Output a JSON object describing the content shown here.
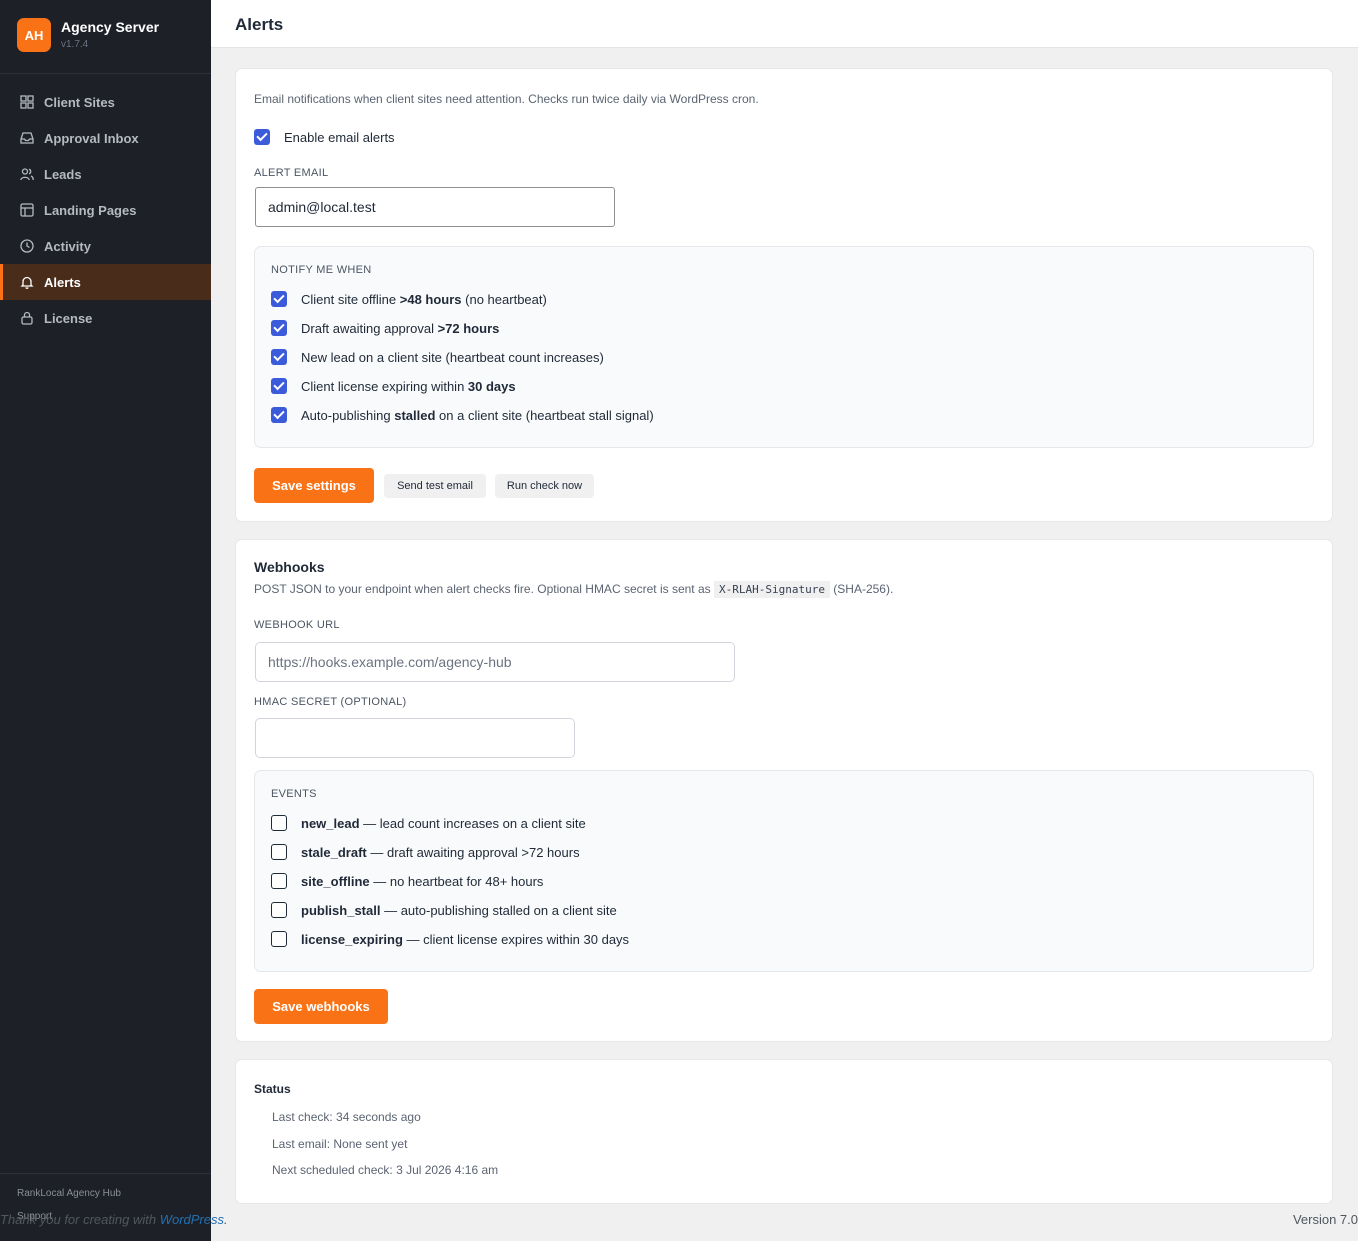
{
  "app": {
    "logo": "AH",
    "title": "Agency Server",
    "version": "v1.7.4"
  },
  "nav": [
    {
      "label": "Client Sites",
      "icon": "grid-icon"
    },
    {
      "label": "Approval Inbox",
      "icon": "inbox-icon"
    },
    {
      "label": "Leads",
      "icon": "users-icon"
    },
    {
      "label": "Landing Pages",
      "icon": "layout-icon"
    },
    {
      "label": "Activity",
      "icon": "clock-icon"
    },
    {
      "label": "Alerts",
      "icon": "bell-icon",
      "active": true
    },
    {
      "label": "License",
      "icon": "lock-icon"
    }
  ],
  "sidebar_footer": {
    "brand": "RankLocal Agency Hub",
    "support": "Support"
  },
  "page": {
    "title": "Alerts"
  },
  "email_card": {
    "description": "Email notifications when client sites need attention. Checks run twice daily via WordPress cron.",
    "enable_label": "Enable email alerts",
    "enable_checked": true,
    "email_label": "ALERT EMAIL",
    "email_value": "admin@local.test",
    "notify_label": "NOTIFY ME WHEN",
    "notify_items": [
      {
        "pre": "Client site offline ",
        "bold": ">48 hours",
        "post": " (no heartbeat)",
        "checked": true
      },
      {
        "pre": "Draft awaiting approval ",
        "bold": ">72 hours",
        "post": "",
        "checked": true
      },
      {
        "pre": "New lead on a client site (heartbeat count increases)",
        "bold": "",
        "post": "",
        "checked": true
      },
      {
        "pre": "Client license expiring within ",
        "bold": "30 days",
        "post": "",
        "checked": true
      },
      {
        "pre": "Auto-publishing ",
        "bold": "stalled",
        "post": " on a client site (heartbeat stall signal)",
        "checked": true
      }
    ],
    "save_label": "Save settings",
    "test_label": "Send test email",
    "run_label": "Run check now"
  },
  "webhook_card": {
    "title": "Webhooks",
    "desc_pre": "POST JSON to your endpoint when alert checks fire. Optional HMAC secret is sent as",
    "desc_code": "X-RLAH-Signature",
    "desc_post": "(SHA-256).",
    "url_label": "WEBHOOK URL",
    "url_placeholder": "https://hooks.example.com/agency-hub",
    "secret_label": "HMAC SECRET (OPTIONAL)",
    "events_label": "EVENTS",
    "events": [
      {
        "name": "new_lead",
        "desc": " — lead count increases on a client site",
        "checked": false
      },
      {
        "name": "stale_draft",
        "desc": " — draft awaiting approval >72 hours",
        "checked": false
      },
      {
        "name": "site_offline",
        "desc": " — no heartbeat for 48+ hours",
        "checked": false
      },
      {
        "name": "publish_stall",
        "desc": " — auto-publishing stalled on a client site",
        "checked": false
      },
      {
        "name": "license_expiring",
        "desc": " — client license expires within 30 days",
        "checked": false
      }
    ],
    "save_label": "Save webhooks"
  },
  "status_card": {
    "title": "Status",
    "lines": [
      "Last check: 34 seconds ago",
      "Last email: None sent yet",
      "Next scheduled check: 3 Jul 2026 4:16 am"
    ]
  },
  "wp_footer": {
    "thanks_pre": "Thank you for creating with ",
    "thanks_link": "WordPress",
    "thanks_post": ".",
    "version": "Version 7.0"
  }
}
